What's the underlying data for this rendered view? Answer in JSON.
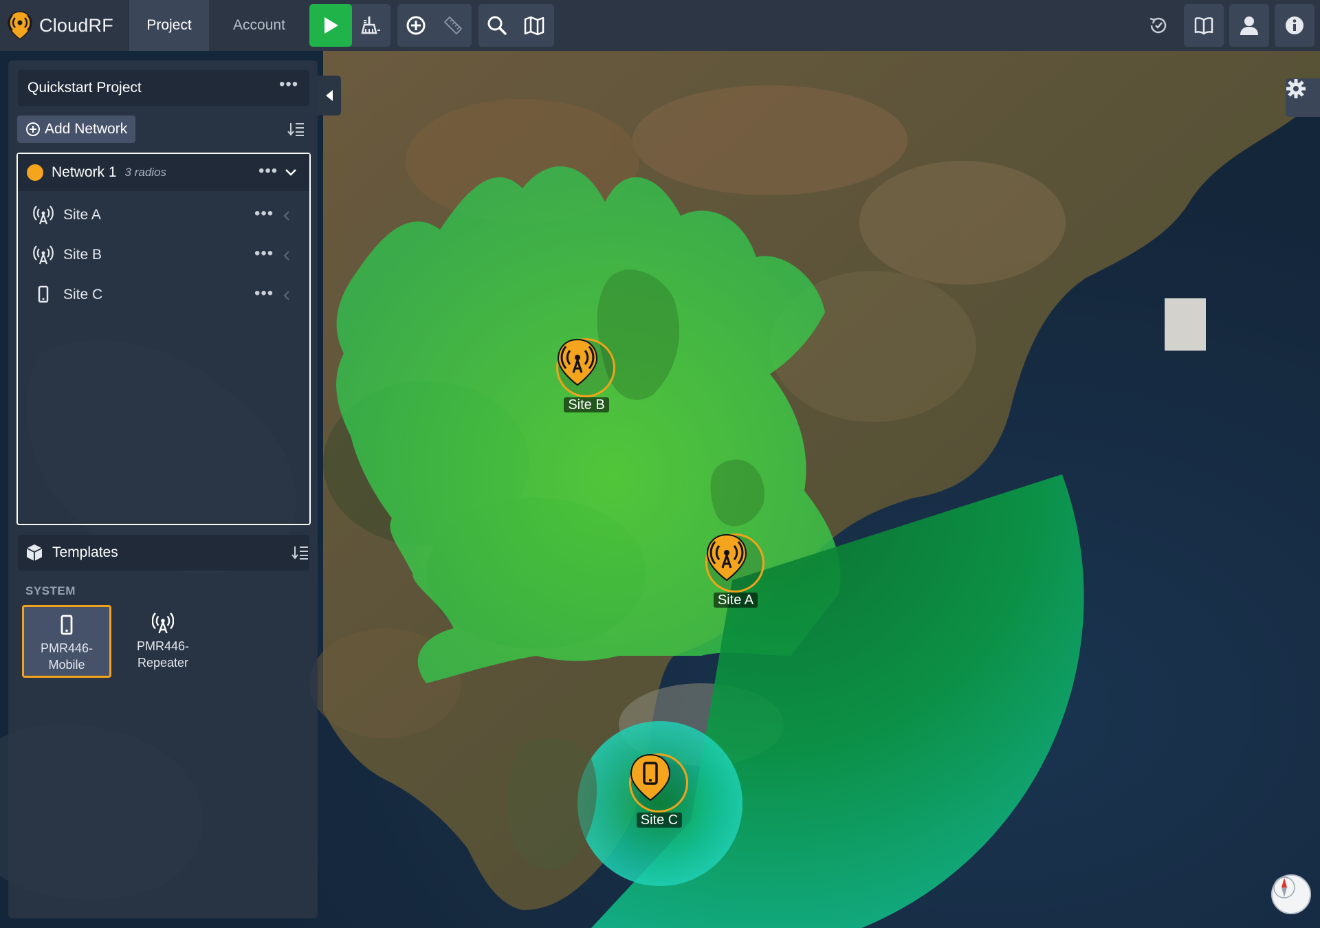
{
  "app": {
    "name": "CloudRF",
    "logo_icon": "cloudrf-logo-icon"
  },
  "nav": {
    "tabs": [
      {
        "label": "Project",
        "active": true
      },
      {
        "label": "Account",
        "active": false
      }
    ]
  },
  "toolbar": {
    "run_icon": "play-icon",
    "clear_icon": "broom-icon",
    "add_icon": "plus-circle-icon",
    "measure_icon": "ruler-icon",
    "search_icon": "search-icon",
    "map_icon": "map-icon",
    "right": [
      "history-icon",
      "book-icon",
      "user-icon",
      "info-icon"
    ],
    "run_color": "#1fb34a"
  },
  "sidebar": {
    "project_title": "Quickstart Project",
    "add_network_label": "Add Network",
    "network": {
      "name": "Network 1",
      "count_label": "3 radios",
      "color": "#f4a41d",
      "radios": [
        {
          "name": "Site A",
          "icon": "antenna-icon"
        },
        {
          "name": "Site B",
          "icon": "antenna-icon"
        },
        {
          "name": "Site C",
          "icon": "mobile-icon"
        }
      ]
    },
    "templates": {
      "title": "Templates",
      "section_label": "SYSTEM",
      "items": [
        {
          "name": "PMR446-Mobile",
          "icon": "mobile-icon",
          "selected": true
        },
        {
          "name": "PMR446-Repeater",
          "icon": "antenna-icon",
          "selected": false
        }
      ]
    }
  },
  "map": {
    "markers": [
      {
        "label": "Site A",
        "icon": "antenna-icon"
      },
      {
        "label": "Site B",
        "icon": "antenna-icon"
      },
      {
        "label": "Site C",
        "icon": "mobile-icon"
      }
    ],
    "settings_icon": "gear-icon",
    "compass_icon": "compass-icon",
    "marker_color": "#f2a31b",
    "coverage_color": "#3ee04a"
  }
}
